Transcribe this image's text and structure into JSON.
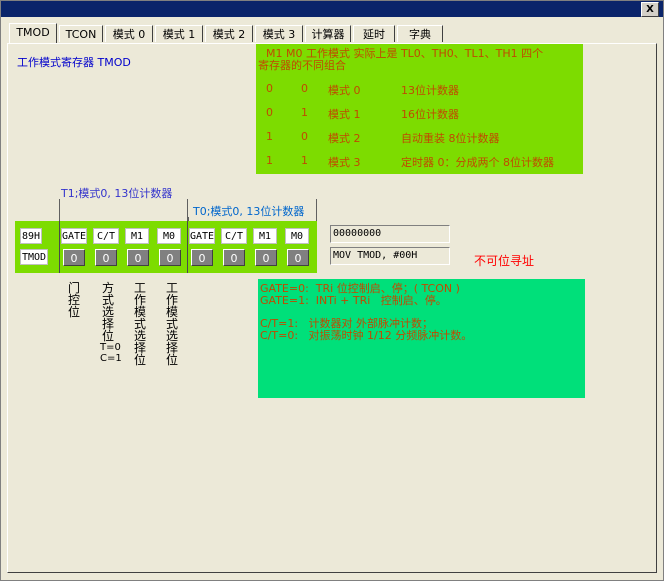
{
  "window": {
    "close_label": "X"
  },
  "tabs": [
    "TMOD",
    "TCON",
    "模式 0",
    "模式 1",
    "模式 2",
    "模式 3",
    "计算器",
    "延时",
    "字典"
  ],
  "reg_title": "工作模式寄存器 TMOD",
  "mode_box": {
    "header1": "M1    M0  工作模式  实际上是 TL0、TH0、TL1、TH1 四个",
    "header2": "寄存器的不同组合",
    "rows": [
      [
        "0",
        "0",
        "模式 0",
        "13位计数器"
      ],
      [
        "0",
        "1",
        "模式 1",
        "16位计数器"
      ],
      [
        "1",
        "0",
        "模式 2",
        "自动重装 8位计数器"
      ],
      [
        "1",
        "1",
        "模式 3",
        "定时器 0：分成两个 8位计数器"
      ]
    ]
  },
  "t1_label": "T1;模式0, 13位计数器",
  "t0_label": "T0;模式0, 13位计数器",
  "register": {
    "addr": "89H",
    "name": "TMOD",
    "bits": [
      "GATE",
      "C/T",
      "M1",
      "M0",
      "GATE",
      "C/T",
      "M1",
      "M0"
    ],
    "values": [
      "0",
      "0",
      "0",
      "0",
      "0",
      "0",
      "0",
      "0"
    ]
  },
  "vertical_labels": {
    "gate": "门控位",
    "ct": "方式选择位",
    "ct_extra1": "T=0",
    "ct_extra2": "C=1",
    "m1": "工作模式选择位",
    "m0": "工作模式选择位"
  },
  "binary_field": "00000000",
  "asm_field": "MOV  TMOD,   #00H",
  "not_bit_addressable": "不可位寻址",
  "description": {
    "line1": "GATE=0:  TRi 位控制启、停；( TCON )",
    "line2": "GATE=1:  INTi + TRi   控制启、停。",
    "line3": "C/T=1:   计数器对 外部脉冲计数；",
    "line4": "C/T=0:   对振荡时钟 1/12 分频脉冲计数。"
  },
  "colors": {
    "mode_box_bg": "#7ddc00",
    "desc_box_bg": "#00e07a",
    "mode_text": "#c04a00",
    "t1_label": "#3333cc",
    "t0_label": "#0066cc",
    "title_bar": "#0a246a",
    "warn_text": "#ff0000"
  }
}
